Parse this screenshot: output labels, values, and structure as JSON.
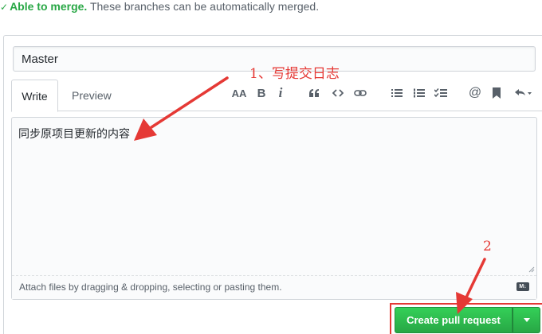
{
  "merge_status": {
    "check_glyph": "✓",
    "able_text": "Able to merge.",
    "description": "These branches can be automatically merged."
  },
  "title_input": {
    "value": "Master"
  },
  "tabs": [
    {
      "label": "Write",
      "active": true
    },
    {
      "label": "Preview",
      "active": false
    }
  ],
  "toolbar": {
    "icons": [
      "text-size-icon",
      "bold-icon",
      "italic-icon",
      "quote-icon",
      "code-icon",
      "link-icon",
      "bulleted-list-icon",
      "numbered-list-icon",
      "task-list-icon",
      "mention-icon",
      "bookmark-icon",
      "reply-icon"
    ],
    "labels": {
      "text_size": "AA",
      "bold": "B",
      "italic": "i",
      "mention": "@"
    }
  },
  "comment": {
    "text": "同步原项目更新的内容",
    "attach_hint": "Attach files by dragging & dropping, selecting or pasting them.",
    "markdown_badge": "M↓"
  },
  "buttons": {
    "create_pull_request": "Create pull request"
  },
  "annotations": {
    "step1": "1、写提交日志",
    "step2": "2",
    "color": "#e53935"
  },
  "colors": {
    "accent_green": "#28a745",
    "border": "#d1d5da",
    "muted_text": "#586069"
  }
}
